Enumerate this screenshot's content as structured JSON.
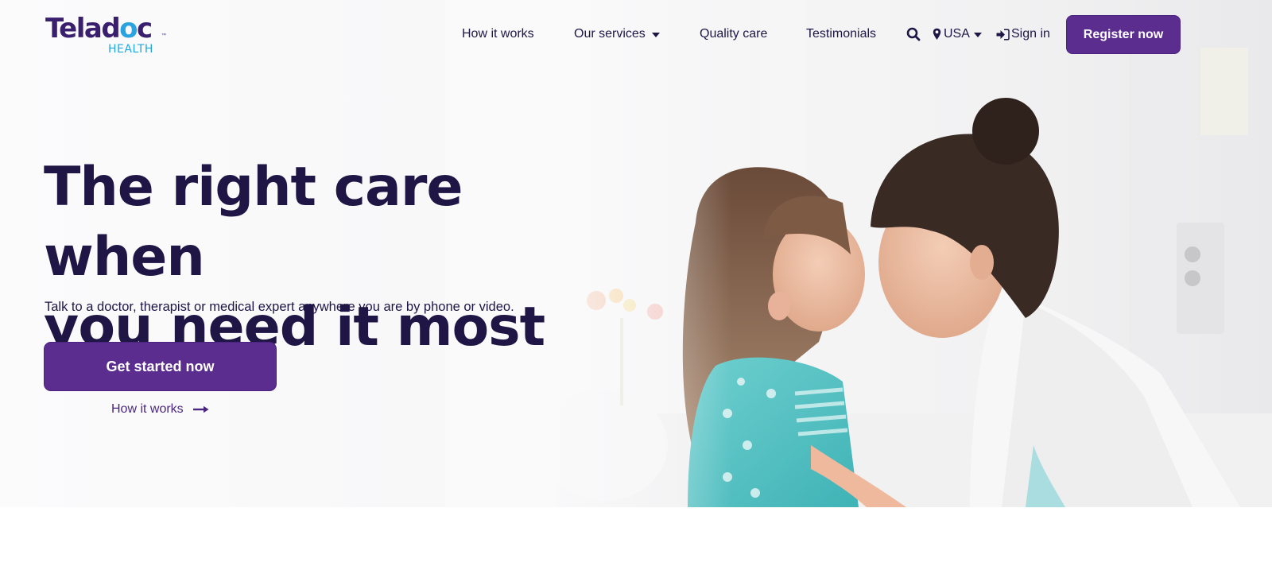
{
  "brand": {
    "name": "Teladoc",
    "sub": "HEALTH",
    "tm": "™",
    "colors": {
      "primary": "#5b2d8f",
      "text": "#1f1646",
      "accent": "#1fa8e0"
    }
  },
  "nav": {
    "items": [
      {
        "label": "How it works",
        "has_dropdown": false
      },
      {
        "label": "Our services",
        "has_dropdown": true
      },
      {
        "label": "Quality care",
        "has_dropdown": false
      },
      {
        "label": "Testimonials",
        "has_dropdown": false
      }
    ],
    "search_icon": "search-icon",
    "region": {
      "icon": "map-pin-icon",
      "label": "USA"
    },
    "sign_in": {
      "icon": "sign-in-icon",
      "label": "Sign in"
    },
    "register_label": "Register now"
  },
  "hero": {
    "headline_line1": "The right care when",
    "headline_line2": "you need it most",
    "subtext": "Talk to a doctor, therapist or medical expert anywhere you are by phone or video.",
    "cta_label": "Get started now",
    "secondary_link": "How it works",
    "secondary_icon": "arrow-right-icon",
    "image_alt": "Mother and young daughter touching foreheads"
  }
}
